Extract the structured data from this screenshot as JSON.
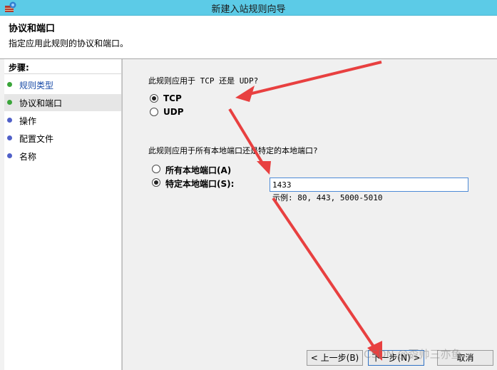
{
  "window": {
    "title": "新建入站规则向导"
  },
  "header": {
    "title": "协议和端口",
    "subtitle": "指定应用此规则的协议和端口。"
  },
  "steps": {
    "label": "步骤:",
    "items": [
      {
        "label": "规则类型"
      },
      {
        "label": "协议和端口"
      },
      {
        "label": "操作"
      },
      {
        "label": "配置文件"
      },
      {
        "label": "名称"
      }
    ]
  },
  "protocol": {
    "question": "此规则应用于 TCP 还是 UDP?",
    "options": [
      {
        "label": "TCP",
        "selected": true
      },
      {
        "label": "UDP",
        "selected": false
      }
    ]
  },
  "ports": {
    "question": "此规则应用于所有本地端口还是特定的本地端口?",
    "options": [
      {
        "label": "所有本地端口(A)",
        "selected": false
      },
      {
        "label": "特定本地端口(S):",
        "selected": true
      }
    ],
    "value": "1433",
    "example": "示例: 80, 443, 5000-5010"
  },
  "buttons": {
    "back": "< 上一步(B)",
    "next": "下一步(N) >",
    "cancel": "取消"
  },
  "watermark": "CSDN @孬帅三亦鱼",
  "colors": {
    "titlebar": "#5ccbe7",
    "annotation_arrow": "#e84040",
    "step_done": "#3aa53a",
    "step_pending": "#5060c8"
  }
}
